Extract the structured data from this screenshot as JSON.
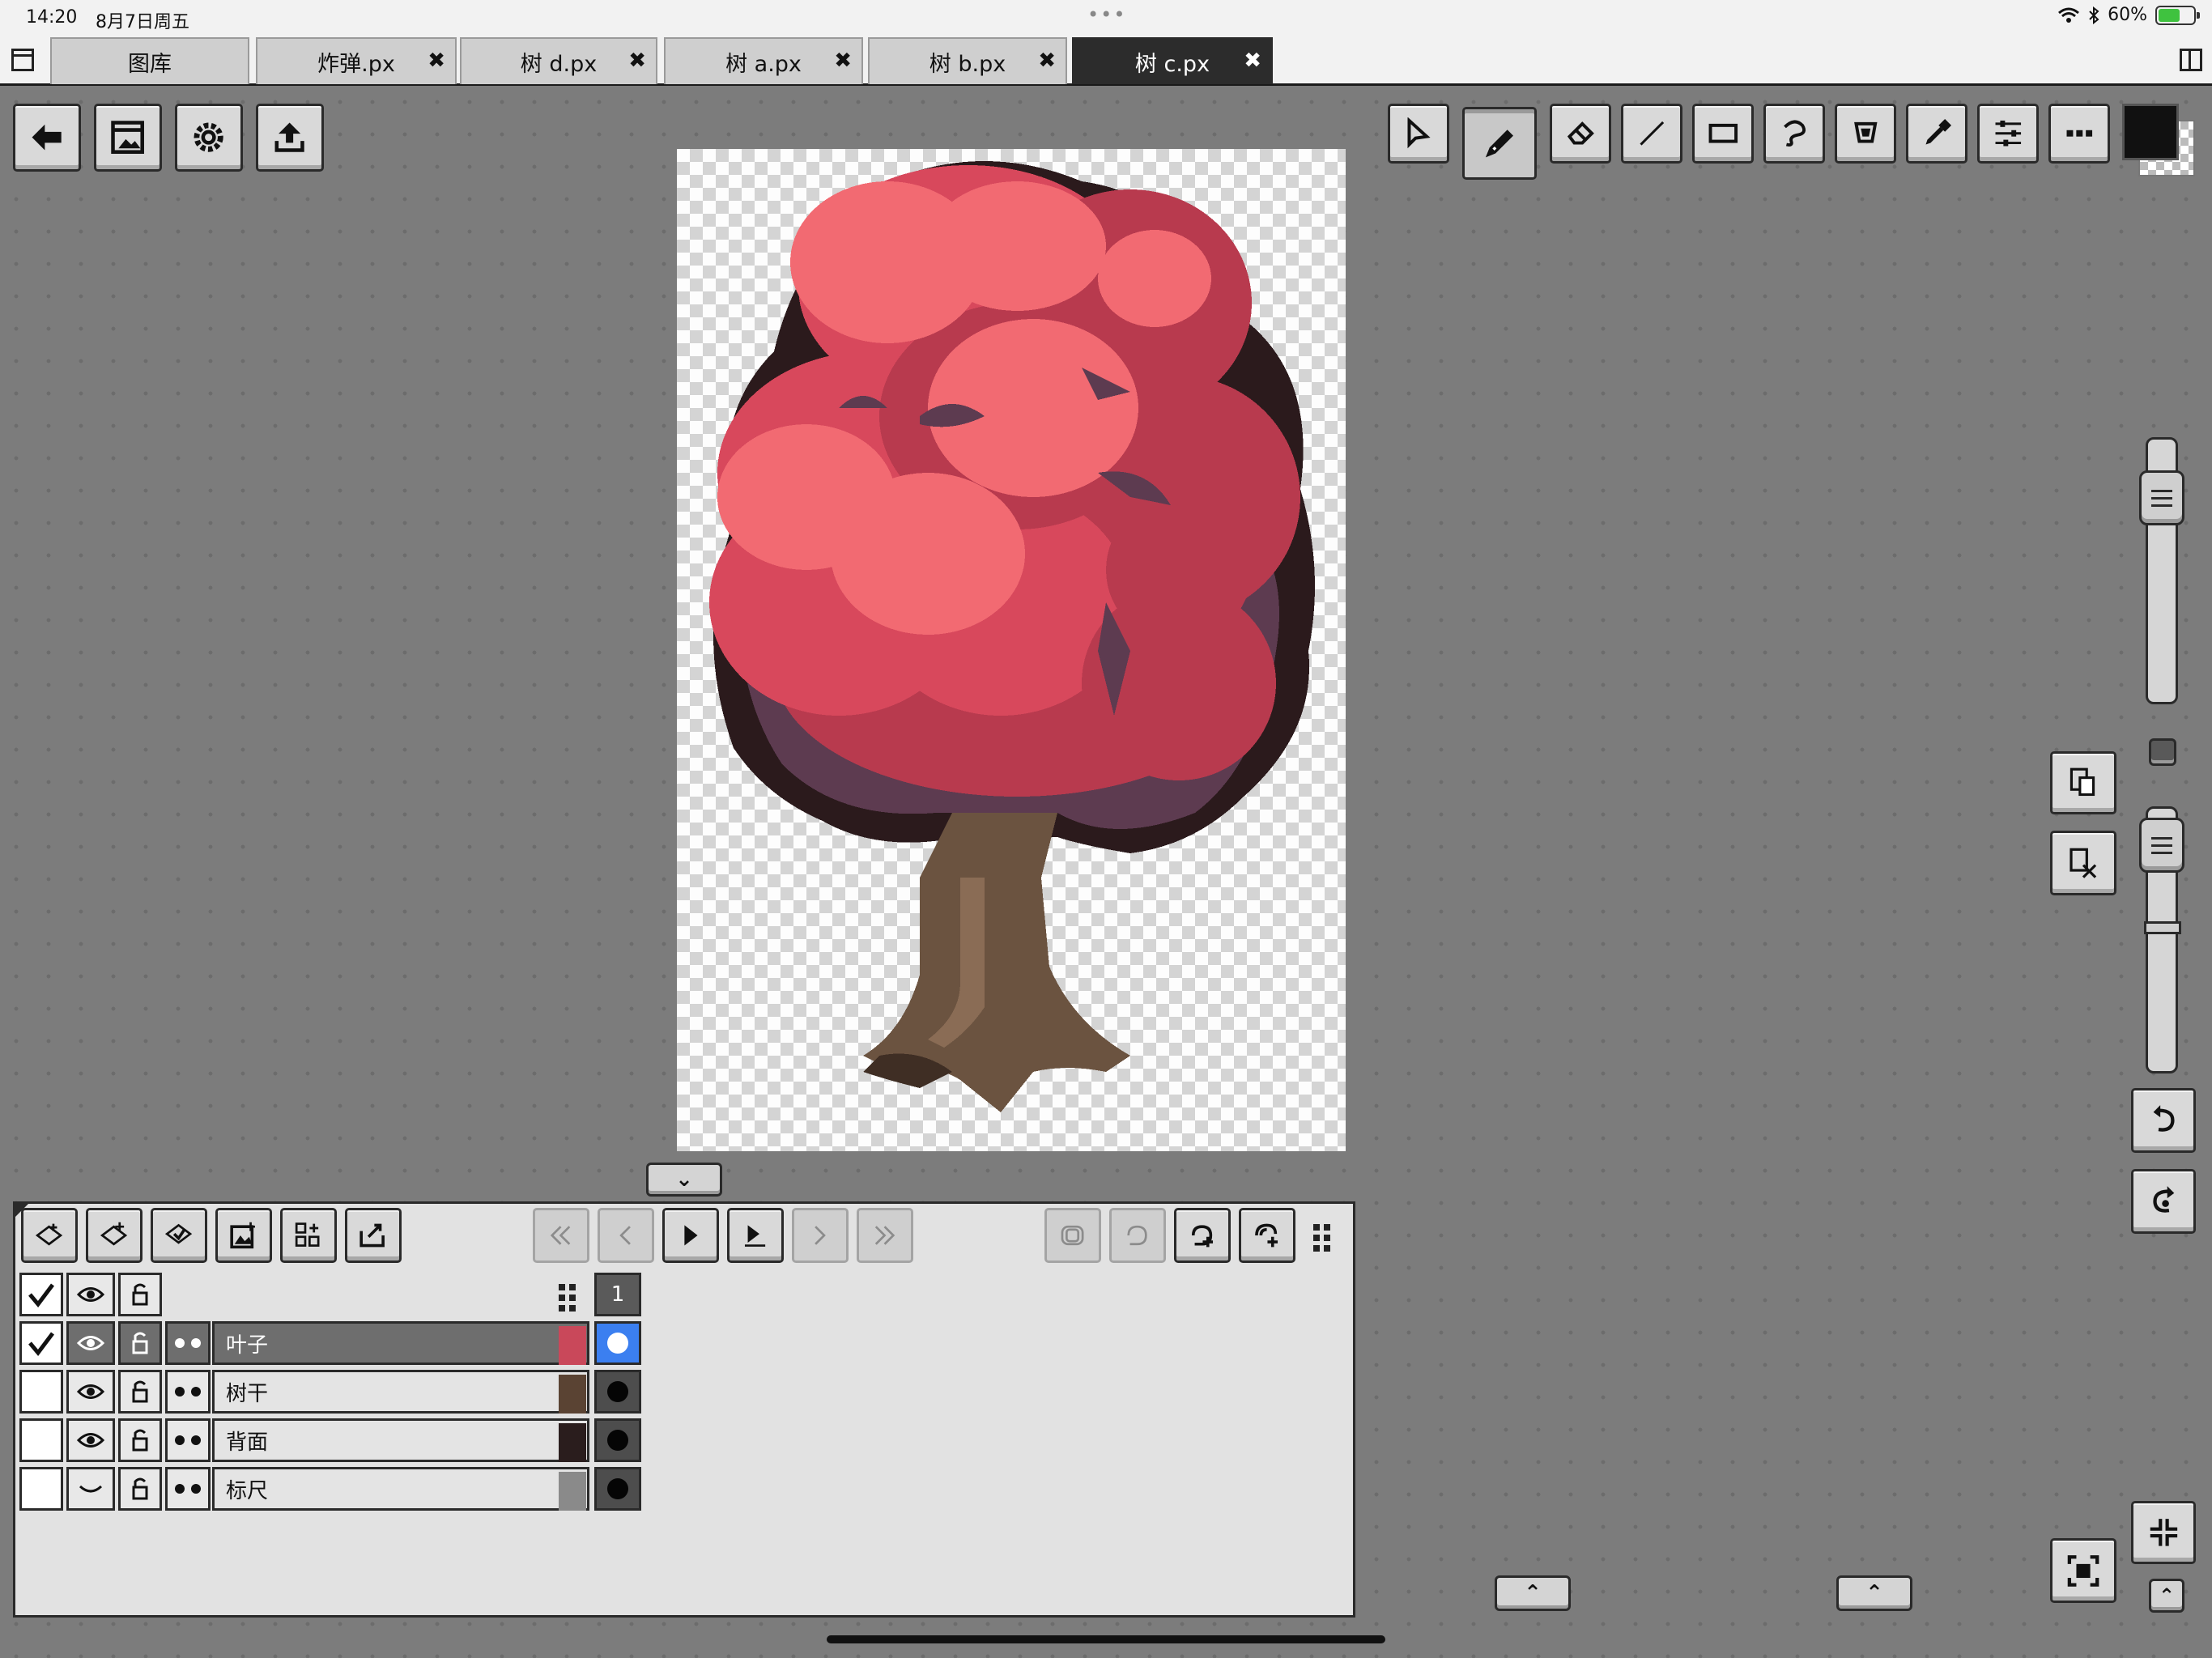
{
  "status": {
    "time": "14:20",
    "date": "8月7日周五",
    "battery": "60%",
    "battery_level": 0.6
  },
  "tabs": [
    {
      "label": "图库",
      "closable": false,
      "active": false
    },
    {
      "label": "炸弹.px",
      "closable": true,
      "active": false
    },
    {
      "label": "树 d.px",
      "closable": true,
      "active": false
    },
    {
      "label": "树 a.px",
      "closable": true,
      "active": false
    },
    {
      "label": "树 b.px",
      "closable": true,
      "active": false
    },
    {
      "label": "树 c.px",
      "closable": true,
      "active": true
    }
  ],
  "tab_close_glyph": "✖",
  "left_toolbar": [
    "back-icon",
    "export-image-icon",
    "settings-gear-icon",
    "share-upload-icon"
  ],
  "right_toolbar": [
    "select-arrow-icon",
    "pencil-icon",
    "eraser-icon",
    "line-icon",
    "rectangle-icon",
    "lasso-icon",
    "fill-bucket-icon",
    "eyedropper-icon",
    "adjust-sliders-icon",
    "more-icon"
  ],
  "active_tool": "pencil-icon",
  "current_color": "#111111",
  "zoom_slider_level": 0.85,
  "opacity_slider_level": 0.05,
  "collapse_glyph": "⌄",
  "expand_glyph": "⌃",
  "layers": {
    "toolbar": [
      "new-layer-icon",
      "duplicate-layer-icon",
      "merge-layer-icon",
      "import-image-layer-icon",
      "layer-grid-icon",
      "layer-export-icon"
    ],
    "playback": [
      "first-frame-icon",
      "prev-frame-icon",
      "play-icon",
      "onion-icon",
      "next-frame-icon",
      "last-frame-icon"
    ],
    "frame_tools": [
      "frame-copy-icon",
      "frame-loop-icon",
      "frame-add-icon",
      "frame-add-multi-icon"
    ],
    "frame_number": "1",
    "rows": [
      {
        "name": "叶子",
        "checked": true,
        "visible": true,
        "selected": true,
        "thumb_color": "#c9485a"
      },
      {
        "name": "树干",
        "checked": false,
        "visible": true,
        "selected": false,
        "thumb_color": "#5a4333"
      },
      {
        "name": "背面",
        "checked": false,
        "visible": true,
        "selected": false,
        "thumb_color": "#2a1d1d"
      },
      {
        "name": "标尺",
        "checked": false,
        "visible": false,
        "selected": false,
        "thumb_color": "#8a8a8a"
      }
    ]
  },
  "palette": {
    "leaf_light": "#f26a72",
    "leaf_mid": "#d8485c",
    "leaf_dark": "#b83a4e",
    "leaf_shadow": "#5d3b50",
    "outline": "#2b1a1c",
    "trunk": "#6b5340",
    "trunk_light": "#8a6c55",
    "trunk_dark": "#3f2e24",
    "accent_blue": "#3b7ff0"
  }
}
